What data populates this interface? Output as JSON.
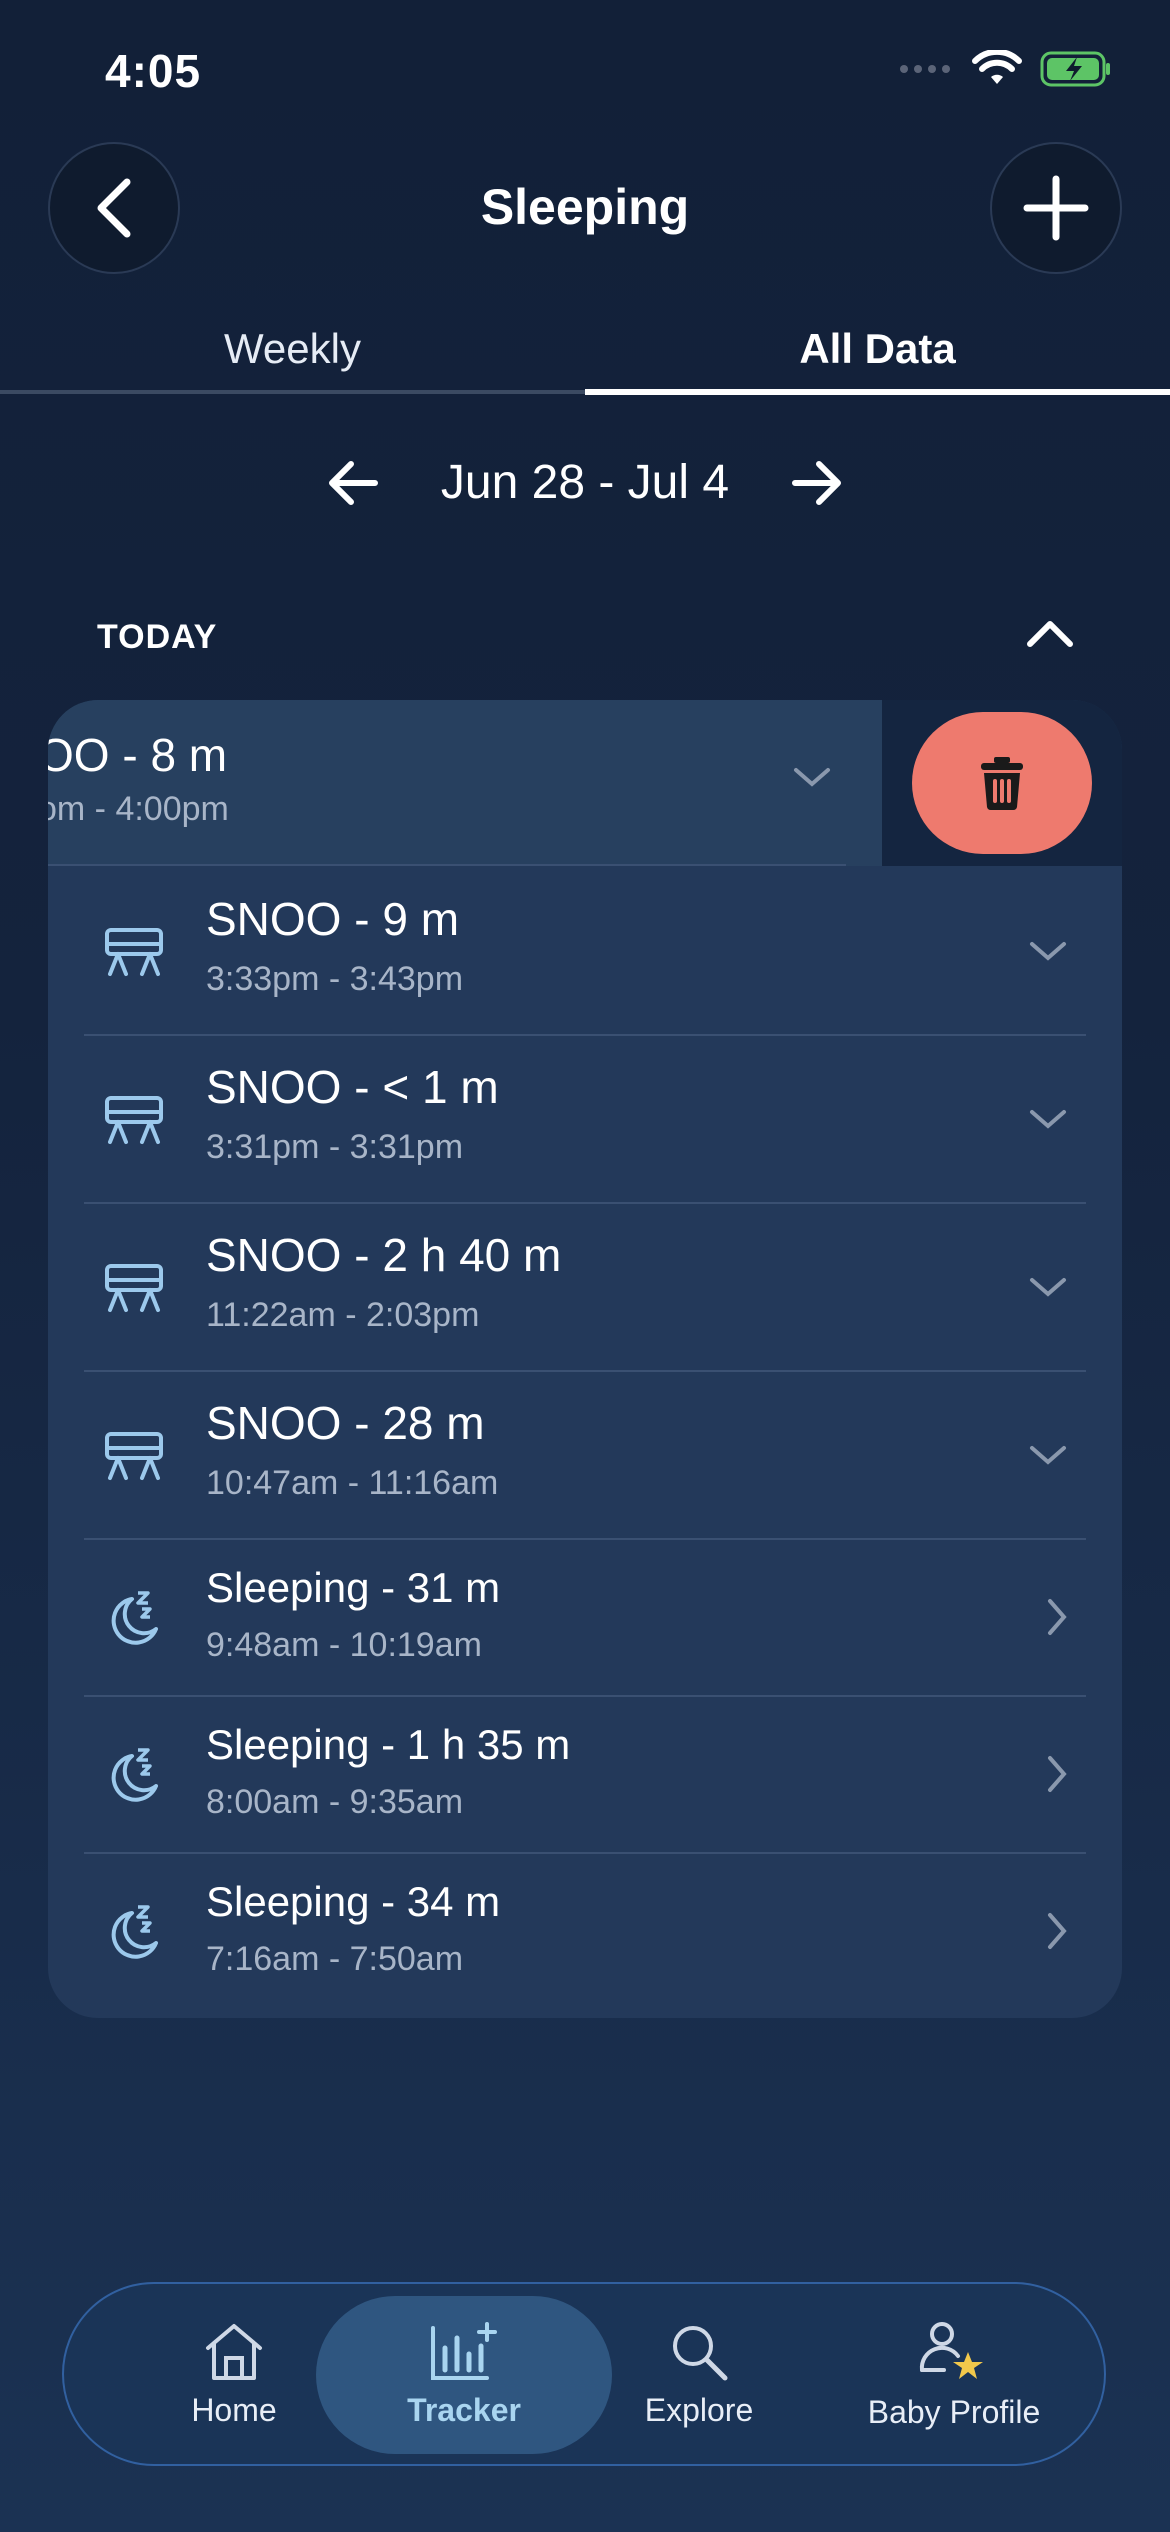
{
  "status_bar": {
    "time": "4:05"
  },
  "header": {
    "title": "Sleeping"
  },
  "tabs": [
    {
      "label": "Weekly"
    },
    {
      "label": "All Data"
    }
  ],
  "date_range": {
    "label": "Jun 28 - Jul 4"
  },
  "section": {
    "label": "TODAY"
  },
  "swiped_row": {
    "title": "OO - 8 m",
    "time": "om - 4:00pm"
  },
  "entries": [
    {
      "title": "SNOO - 9 m",
      "time": "3:33pm - 3:43pm",
      "icon": "snoo-bassinet-icon"
    },
    {
      "title": "SNOO - < 1 m",
      "time": "3:31pm - 3:31pm",
      "icon": "snoo-bassinet-icon"
    },
    {
      "title": "SNOO - 2 h 40 m",
      "time": "11:22am - 2:03pm",
      "icon": "snoo-bassinet-icon"
    },
    {
      "title": "SNOO - 28 m",
      "time": "10:47am - 11:16am",
      "icon": "snoo-bassinet-icon"
    },
    {
      "title": "Sleeping - 31 m",
      "time": "9:48am - 10:19am",
      "icon": "moon-sleep-icon"
    },
    {
      "title": "Sleeping - 1 h 35 m",
      "time": "8:00am - 9:35am",
      "icon": "moon-sleep-icon"
    },
    {
      "title": "Sleeping - 34 m",
      "time": "7:16am - 7:50am",
      "icon": "moon-sleep-icon"
    }
  ],
  "nav": [
    {
      "label": "Home",
      "icon": "home-icon"
    },
    {
      "label": "Tracker",
      "icon": "tracker-chart-icon"
    },
    {
      "label": "Explore",
      "icon": "search-icon"
    },
    {
      "label": "Baby Profile",
      "icon": "baby-profile-icon"
    }
  ],
  "colors": {
    "delete": "#ee7a6e",
    "accent": "#a9d5f0",
    "card": "#23395a"
  }
}
